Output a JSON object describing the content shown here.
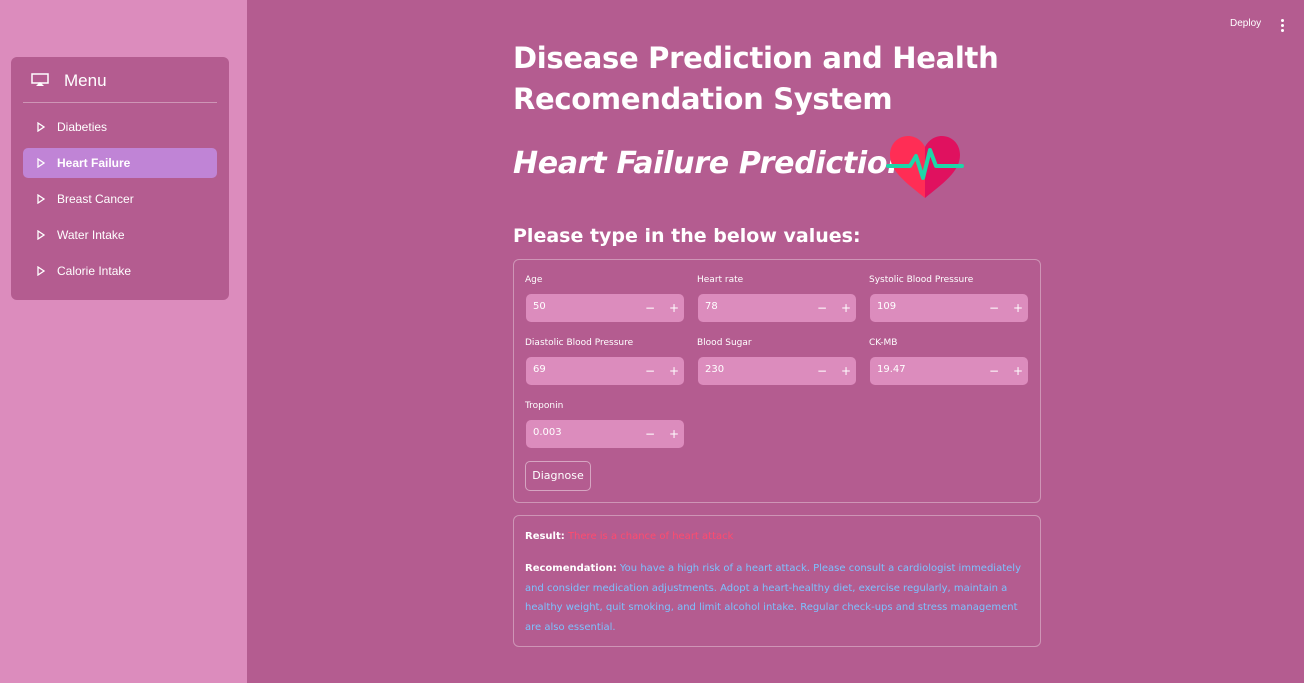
{
  "app": {
    "deploy_label": "Deploy"
  },
  "sidebar": {
    "menu_title": "Menu",
    "items": [
      {
        "label": "Diabeties",
        "active": false
      },
      {
        "label": "Heart Failure",
        "active": true
      },
      {
        "label": "Breast Cancer",
        "active": false
      },
      {
        "label": "Water Intake",
        "active": false
      },
      {
        "label": "Calorie Intake",
        "active": false
      }
    ]
  },
  "main": {
    "title": "Disease Prediction and Health Recomendation System",
    "subtitle": "Heart Failure Prediction",
    "prompt": "Please type in the below values:",
    "fields": [
      {
        "label": "Age",
        "value": "50"
      },
      {
        "label": "Heart rate",
        "value": "78"
      },
      {
        "label": "Systolic Blood Pressure",
        "value": "109"
      },
      {
        "label": "Diastolic Blood Pressure",
        "value": "69"
      },
      {
        "label": "Blood Sugar",
        "value": "230"
      },
      {
        "label": "CK-MB",
        "value": "19.47"
      },
      {
        "label": "Troponin",
        "value": "0.003"
      }
    ],
    "stepper_minus": "−",
    "stepper_plus": "+",
    "diagnose_label": "Diagnose",
    "result_label": "Result:",
    "result_text": "There is a chance of heart attack",
    "recommendation_label": "Recomendation:",
    "recommendation_text": "You have a high risk of a heart attack. Please consult a cardiologist immediately and consider medication adjustments. Adopt a heart-healthy diet, exercise regularly, maintain a healthy weight, quit smoking, and limit alcohol intake. Regular check-ups and stress management are also essential."
  },
  "colors": {
    "main_bg": "#b45c90",
    "sidebar_bg": "#dc8cbd",
    "active_item": "#c084d6",
    "result_text": "#ff4b6e",
    "recommendation_text": "#7cc2ff",
    "heart_left": "#ff2d55",
    "heart_right": "#e0115f",
    "pulse_line": "#1ed6a8"
  },
  "icons": {
    "menu": "monitor-icon",
    "menu_item": "triangle-right-icon",
    "more": "kebab-menu-icon",
    "heart": "heart-pulse-icon"
  }
}
